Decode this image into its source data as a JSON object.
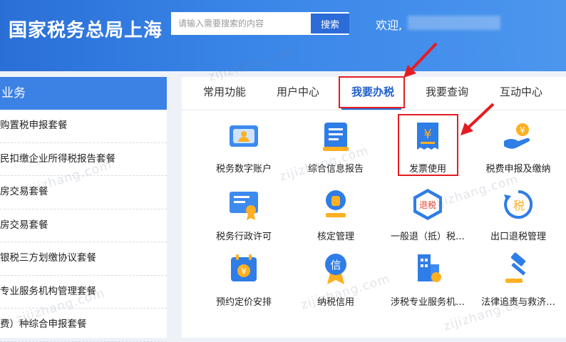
{
  "header": {
    "title": "国家税务总局上海",
    "search_placeholder": "请输入需要搜索的内容",
    "search_button": "搜索",
    "welcome": "欢迎,"
  },
  "sidebar": {
    "heading": "业务",
    "items": [
      "购置税申报套餐",
      "民扣缴企业所得税报告套餐",
      "房交易套餐",
      "房交易套餐",
      "银税三方划缴协议套餐",
      "专业服务机构管理套餐",
      "费）种综合申报套餐"
    ]
  },
  "tabs": [
    "常用功能",
    "用户中心",
    "我要办税",
    "我要查询",
    "互动中心"
  ],
  "tiles": [
    {
      "label": "税务数字账户",
      "icon": "digital-account-icon"
    },
    {
      "label": "综合信息报告",
      "icon": "info-report-icon"
    },
    {
      "label": "发票使用",
      "icon": "invoice-icon"
    },
    {
      "label": "税费申报及缴纳",
      "icon": "tax-payment-icon"
    },
    {
      "label": "税务行政许可",
      "icon": "admin-license-icon"
    },
    {
      "label": "核定管理",
      "icon": "verification-stamp-icon"
    },
    {
      "label": "一般退（抵）税…",
      "icon": "refund-icon",
      "badge": "退税"
    },
    {
      "label": "出口退税管理",
      "icon": "export-refund-icon",
      "badge": "税"
    },
    {
      "label": "预约定价安排",
      "icon": "calendar-yen-icon"
    },
    {
      "label": "纳税信用",
      "icon": "credit-medal-icon",
      "badge": "信"
    },
    {
      "label": "涉税专业服务机…",
      "icon": "service-building-icon"
    },
    {
      "label": "法律追责与救济…",
      "icon": "gavel-icon"
    }
  ],
  "watermark": "zijizhang.com",
  "colors": {
    "brand_blue": "#2a6fd6",
    "highlight_red": "#e51c23"
  }
}
